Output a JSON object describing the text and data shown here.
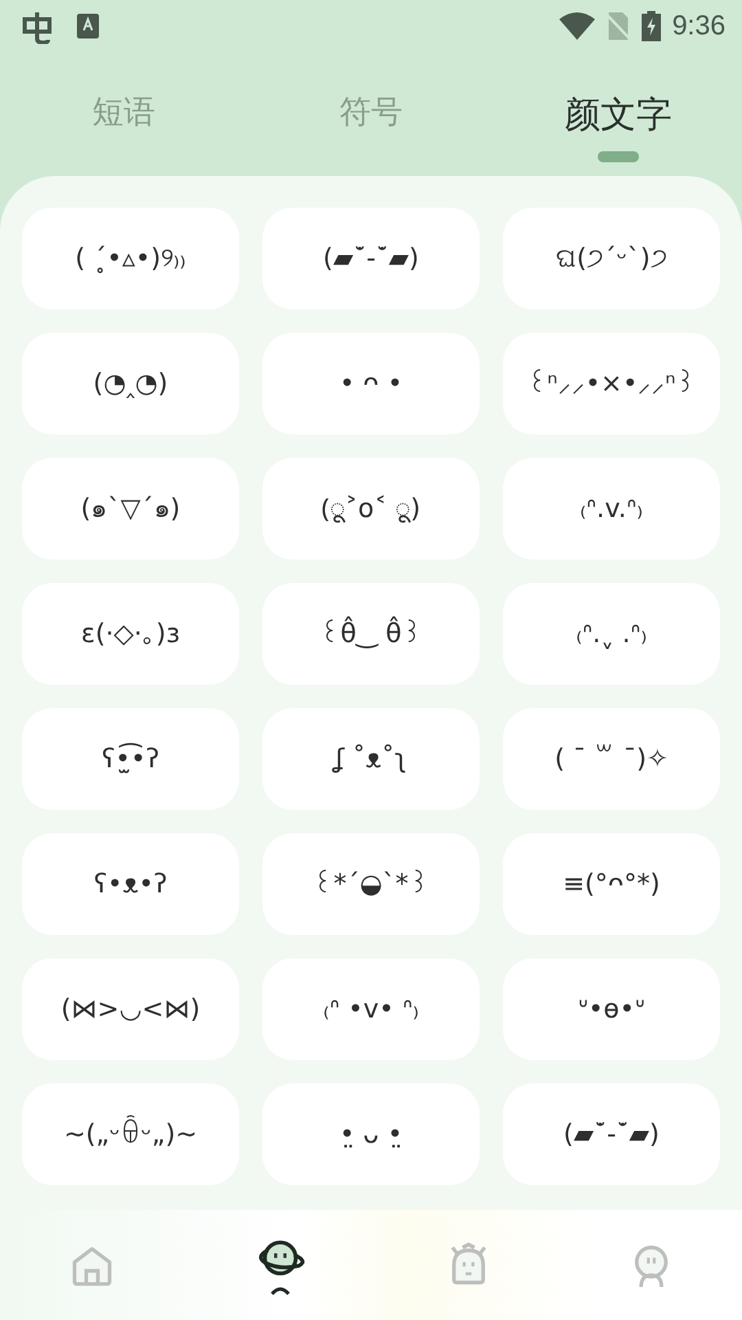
{
  "status_bar": {
    "time": "9:36"
  },
  "tabs": [
    {
      "label": "短语",
      "selected": false
    },
    {
      "label": "符号",
      "selected": false
    },
    {
      "label": "颜文字",
      "selected": true
    }
  ],
  "kaomoji": [
    "( ´̥•▵•)୨₎₎",
    "(▰˘̇-˘̇▰)",
    "ଘ(੭ˊᵕˋ)੭",
    "(◔‸◔)",
    "• ᴖ •",
    "꒰ⁿ⸝⸝•×•⸝⸝ⁿ꒱",
    "(๑ˋ▽ˊ๑)",
    "(ू˃o˂ ू)",
    "₍ᐢ.v.ᐢ₎",
    "ɛ(·◇·｡)ɜ",
    "꒰θ̂‿ θ̂꒱",
    "₍ᐢ.ˬ .ᐢ₎",
    "ʕ•̫͡•ʔ",
    "ʆ ˚ᴥ˚ʅ",
    "( ¯ ꒳ ¯)✧",
    "ʕ•ᴥ•ʔ",
    "꒰*ˊ◒ˋ*꒱",
    "≡(°ᴖ°*)",
    "(⋈>◡<⋈)",
    "₍ᐢ •v• ᐢ₎",
    "ᐡ•ө•ᐡ",
    "~(„ᵕꌶᵕ„)~",
    "•̤ ᴗ •̤",
    "(▰˘̇-˘̇▰)"
  ],
  "bottom_nav": [
    {
      "kind": "home",
      "selected": false
    },
    {
      "kind": "planet",
      "selected": true
    },
    {
      "kind": "robot",
      "selected": false
    },
    {
      "kind": "person",
      "selected": false
    }
  ]
}
